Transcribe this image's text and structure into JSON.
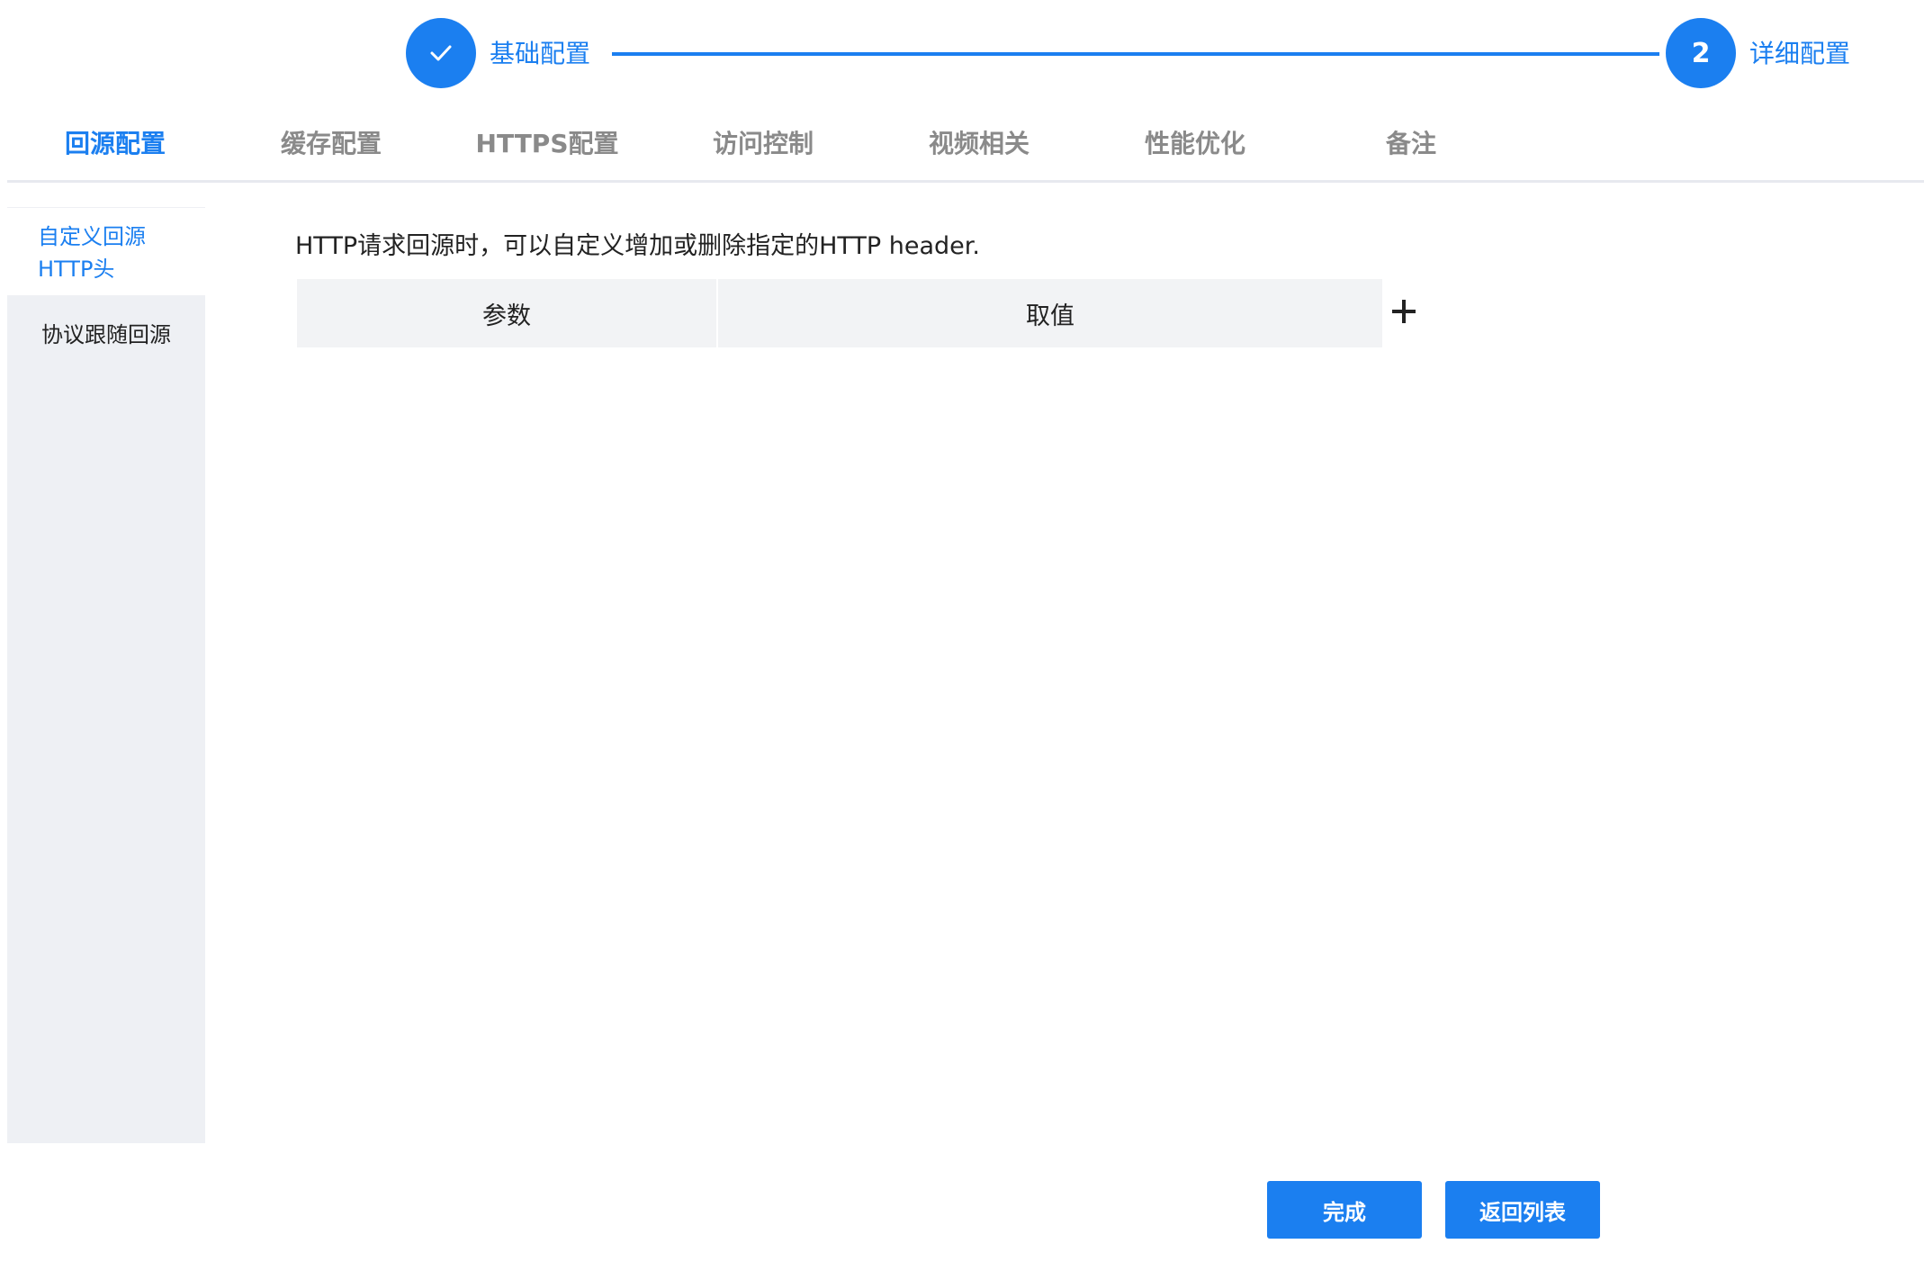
{
  "stepper": {
    "steps": [
      {
        "label": "基础配置",
        "state": "completed",
        "icon": "check-icon"
      },
      {
        "number": "2",
        "label": "详细配置",
        "state": "current"
      }
    ],
    "accent_color": "#1b7ff0"
  },
  "tabs": [
    {
      "label": "回源配置",
      "active": true
    },
    {
      "label": "缓存配置",
      "active": false
    },
    {
      "label": "HTTPS配置",
      "active": false
    },
    {
      "label": "访问控制",
      "active": false
    },
    {
      "label": "视频相关",
      "active": false
    },
    {
      "label": "性能优化",
      "active": false
    },
    {
      "label": "备注",
      "active": false
    }
  ],
  "side_menu": {
    "items": [
      {
        "label_line1": "自定义回源",
        "label_line2": "HTTP头",
        "active": true
      },
      {
        "label": "协议跟随回源",
        "active": false
      }
    ]
  },
  "main": {
    "description": "HTTP请求回源时，可以自定义增加或删除指定的HTTP header.",
    "table": {
      "columns": [
        "参数",
        "取值"
      ],
      "rows": []
    },
    "add_icon": "plus-icon"
  },
  "footer": {
    "finish_label": "完成",
    "back_label": "返回列表"
  }
}
